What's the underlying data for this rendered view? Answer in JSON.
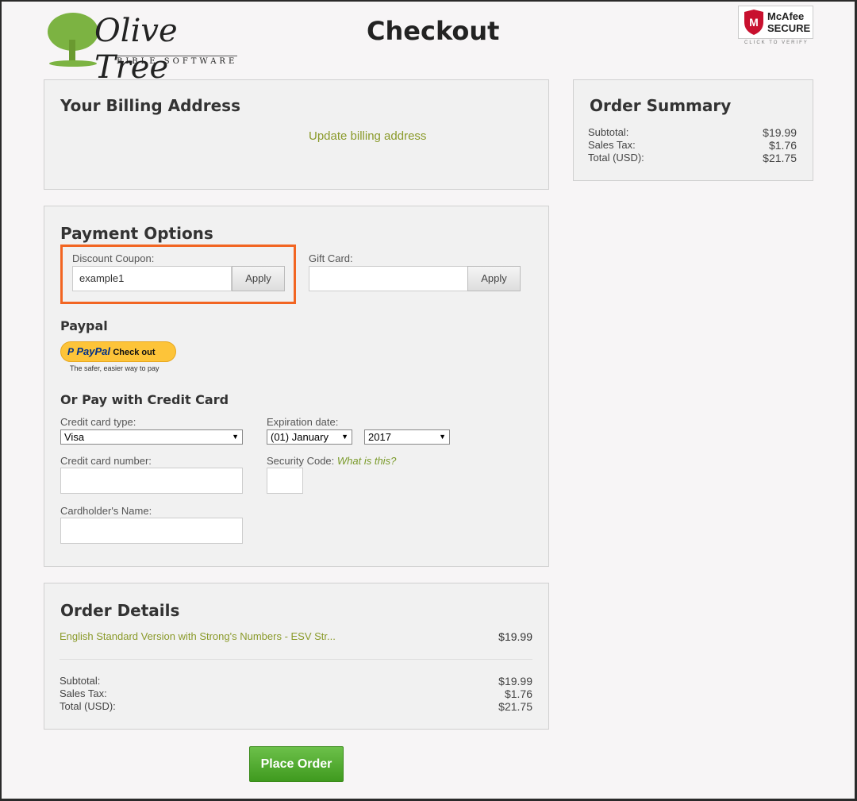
{
  "header": {
    "logo_text": "Olive Tree",
    "logo_sub": "BIBLE SOFTWARE",
    "title": "Checkout",
    "badge_brand": "McAfee",
    "badge_secure": "SECURE",
    "badge_verify": "CLICK TO VERIFY"
  },
  "billing": {
    "heading": "Your Billing Address",
    "update_link": "Update billing address"
  },
  "summary": {
    "heading": "Order Summary",
    "rows": [
      {
        "label": "Subtotal:",
        "value": "$19.99"
      },
      {
        "label": "Sales Tax:",
        "value": "$1.76"
      },
      {
        "label": "Total (USD):",
        "value": "$21.75"
      }
    ]
  },
  "payment": {
    "heading": "Payment Options",
    "coupon_label": "Discount Coupon:",
    "coupon_value": "example1",
    "apply": "Apply",
    "gift_label": "Gift Card:",
    "gift_value": "",
    "paypal_heading": "Paypal",
    "paypal_brand": "PayPal",
    "paypal_checkout": "Check out",
    "paypal_tagline": "The safer, easier way to pay",
    "cc_heading": "Or Pay with Credit Card",
    "cc_type_label": "Credit card type:",
    "cc_type": "Visa",
    "exp_label": "Expiration date:",
    "exp_month": "(01) January",
    "exp_year": "2017",
    "cc_number_label": "Credit card number:",
    "security_label": "Security Code:",
    "security_link": "What is this?",
    "name_label": "Cardholder's Name:",
    "highlight_color": "#f26522"
  },
  "details": {
    "heading": "Order Details",
    "item": "English Standard Version with Strong's Numbers - ESV Str...",
    "item_price": "$19.99",
    "rows": [
      {
        "label": "Subtotal:",
        "value": "$19.99"
      },
      {
        "label": "Sales Tax:",
        "value": "$1.76"
      },
      {
        "label": "Total (USD):",
        "value": "$21.75"
      }
    ]
  },
  "place_order": "Place Order"
}
